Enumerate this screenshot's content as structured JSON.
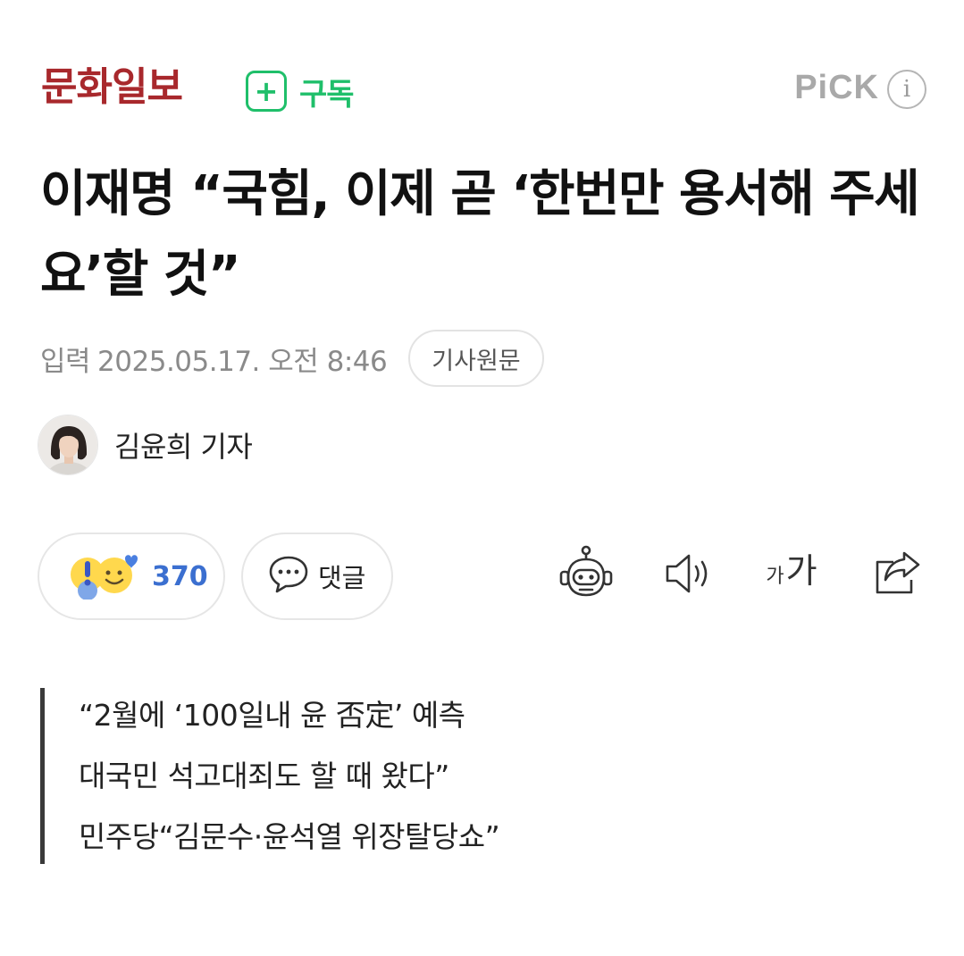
{
  "header": {
    "press_name": "문화일보",
    "subscribe_symbol": "+",
    "subscribe_label": "구독",
    "pick_label": "PiCK",
    "info_symbol": "i"
  },
  "article": {
    "title": "이재명 “국힘, 이제 곧 ‘한번만 용서해 주세요’할 것”",
    "input_label": "입력",
    "date": "2025.05.17. 오전 8:46",
    "original_button": "기사원문",
    "author": "김윤희 기자"
  },
  "actions": {
    "reaction_count": "370",
    "comment_label": "댓글",
    "font_small": "가",
    "font_large": "가"
  },
  "summary": {
    "lines": [
      "“2월에 ‘100일내 윤 否定’ 예측",
      "대국민 석고대죄도 할 때 왔다”",
      "민주당“김문수·윤석열 위장탈당쇼”"
    ]
  },
  "colors": {
    "brand_red": "#a8282c",
    "subscribe_green": "#1fbf6a",
    "reaction_blue": "#3b6fd0",
    "pick_gray": "#a9a9a9"
  },
  "icons": {
    "reaction": "reaction-emoji-icon",
    "comment": "speech-bubble-icon",
    "ai_summary": "robot-icon",
    "tts": "speaker-icon",
    "font_size": "font-size-icon",
    "share": "share-icon",
    "info": "info-icon",
    "subscribe": "plus-icon"
  }
}
